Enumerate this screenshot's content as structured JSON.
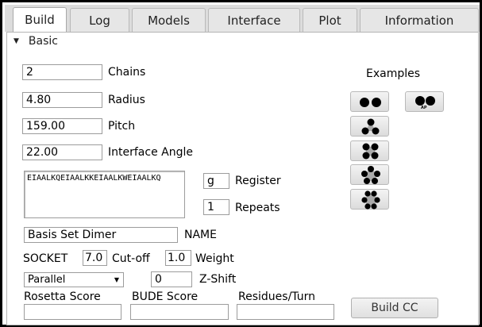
{
  "tabs": [
    "Build",
    "Log",
    "Models",
    "Interface",
    "Plot",
    "Information"
  ],
  "section": {
    "title": "Basic"
  },
  "fields": {
    "chains": {
      "value": "2",
      "label": "Chains"
    },
    "radius": {
      "value": "4.80",
      "label": "Radius"
    },
    "pitch": {
      "value": "159.00",
      "label": "Pitch"
    },
    "interface_angle": {
      "value": "22.00",
      "label": "Interface Angle"
    },
    "sequence": {
      "value": "EIAALKQEIAALKKEIAALKWEIAALKQ"
    },
    "register": {
      "value": "g",
      "label": "Register"
    },
    "repeats": {
      "value": "1",
      "label": "Repeats"
    },
    "name": {
      "value": "Basis Set Dimer",
      "label": "NAME"
    },
    "socket": {
      "label": "SOCKET",
      "cutoff_value": "7.0",
      "cutoff_label": "Cut-off",
      "weight_value": "1.0",
      "weight_label": "Weight"
    },
    "orientation": {
      "value": "Parallel"
    },
    "z_shift": {
      "value": "0",
      "label": "Z-Shift"
    }
  },
  "examples": {
    "title": "Examples",
    "ap_badge": "AP",
    "icons": [
      "dimer-icon",
      "antiparallel-dimer-icon",
      "trimer-icon",
      "tetramer-icon",
      "pentamer-icon",
      "hexamer-icon"
    ]
  },
  "scores": {
    "rosetta_label": "Rosetta Score",
    "rosetta_value": "",
    "bude_label": "BUDE Score",
    "bude_value": "",
    "residues_label": "Residues/Turn",
    "residues_value": ""
  },
  "build_button": "Build CC"
}
